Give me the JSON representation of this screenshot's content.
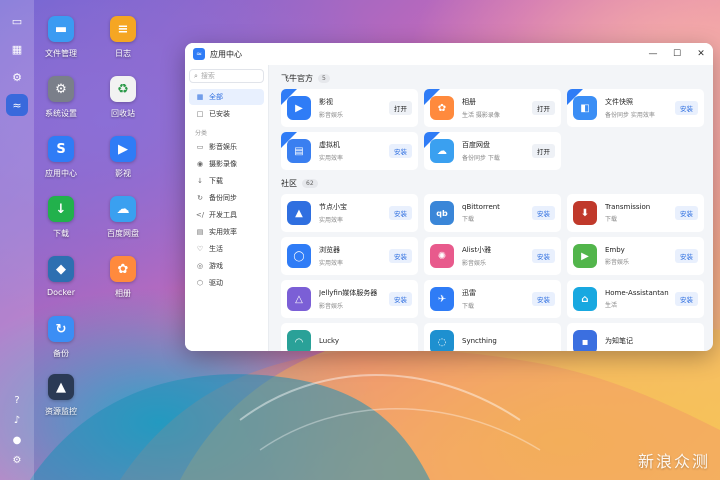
{
  "dock": {
    "top": [
      {
        "icon": "monitor-icon",
        "glyph": "▭"
      },
      {
        "icon": "apps-grid-icon",
        "glyph": "▦"
      },
      {
        "icon": "settings-icon",
        "glyph": "⚙"
      },
      {
        "icon": "app-center-icon",
        "glyph": "≈"
      }
    ],
    "bottom": [
      {
        "icon": "help-icon",
        "glyph": "?"
      },
      {
        "icon": "bell-icon",
        "glyph": "♪"
      },
      {
        "icon": "user-icon",
        "glyph": "●"
      },
      {
        "icon": "gear-icon",
        "glyph": "⚙"
      }
    ]
  },
  "desktop": [
    {
      "label": "文件管理",
      "icon": "folder-icon",
      "glyph": "▬",
      "color": "#3b9bf2"
    },
    {
      "label": "日志",
      "icon": "log-icon",
      "glyph": "≡",
      "color": "#f5a623"
    },
    {
      "label": "系统设置",
      "icon": "settings-icon",
      "glyph": "⚙",
      "color": "#7a7f8a"
    },
    {
      "label": "回收站",
      "icon": "recycle-icon",
      "glyph": "♻",
      "color": "#f2f2f2"
    },
    {
      "label": "应用中心",
      "icon": "store-icon",
      "glyph": "S",
      "color": "#2f7cf6"
    },
    {
      "label": "影视",
      "icon": "video-icon",
      "glyph": "▶",
      "color": "#2f7cf6"
    },
    {
      "label": "下载",
      "icon": "download-icon",
      "glyph": "↓",
      "color": "#22b14c"
    },
    {
      "label": "百度网盘",
      "icon": "cloud-icon",
      "glyph": "☁",
      "color": "#3aa0f0"
    },
    {
      "label": "Docker",
      "icon": "docker-icon",
      "glyph": "◆",
      "color": "#2d6fb1"
    },
    {
      "label": "相册",
      "icon": "photos-icon",
      "glyph": "✿",
      "color": "#ff8a3d"
    },
    {
      "label": "备份",
      "icon": "backup-icon",
      "glyph": "↻",
      "color": "#3b8ef5"
    },
    {
      "label": "资源监控",
      "icon": "monitor-chart-icon",
      "glyph": "▲",
      "color": "#2b3a55"
    }
  ],
  "window": {
    "title": "应用中心",
    "controls": [
      "—",
      "☐",
      "✕"
    ]
  },
  "sidebar": {
    "search_placeholder": "搜索",
    "top_items": [
      {
        "label": "全部",
        "icon": "all-icon",
        "glyph": "▦",
        "active": true
      },
      {
        "label": "已安装",
        "icon": "installed-icon",
        "glyph": "□",
        "active": false
      }
    ],
    "section_title": "分类",
    "categories": [
      {
        "label": "影音娱乐",
        "icon": "media-icon",
        "glyph": "▭"
      },
      {
        "label": "摄影录像",
        "icon": "camera-icon",
        "glyph": "◉"
      },
      {
        "label": "下载",
        "icon": "download-icon",
        "glyph": "↓"
      },
      {
        "label": "备份同步",
        "icon": "sync-icon",
        "glyph": "↻"
      },
      {
        "label": "开发工具",
        "icon": "dev-icon",
        "glyph": "</"
      },
      {
        "label": "实用效率",
        "icon": "tool-icon",
        "glyph": "▤"
      },
      {
        "label": "生活",
        "icon": "life-icon",
        "glyph": "♡"
      },
      {
        "label": "游戏",
        "icon": "game-icon",
        "glyph": "◎"
      },
      {
        "label": "驱动",
        "icon": "driver-icon",
        "glyph": "⬡"
      }
    ]
  },
  "groups": [
    {
      "title": "飞牛官方",
      "count": "5",
      "apps": [
        {
          "name": "影视",
          "desc": "影音娱乐",
          "btn": "打开",
          "install": false,
          "official": true,
          "icon": "video-icon",
          "glyph": "▶",
          "color": "#2f7cf6"
        },
        {
          "name": "相册",
          "desc": "生活  摄影录像",
          "btn": "打开",
          "install": false,
          "official": true,
          "icon": "photos-icon",
          "glyph": "✿",
          "color": "#ff8a3d"
        },
        {
          "name": "文件快照",
          "desc": "备份同步  实用效率",
          "btn": "安装",
          "install": true,
          "official": true,
          "icon": "snapshot-icon",
          "glyph": "◧",
          "color": "#3b8ef5"
        },
        {
          "name": "虚拟机",
          "desc": "实用效率",
          "btn": "安装",
          "install": true,
          "official": true,
          "icon": "vm-icon",
          "glyph": "▤",
          "color": "#3a7ff0"
        },
        {
          "name": "百度网盘",
          "desc": "备份同步  下载",
          "btn": "打开",
          "install": false,
          "official": true,
          "icon": "cloud-icon",
          "glyph": "☁",
          "color": "#3aa0f0"
        }
      ]
    },
    {
      "title": "社区",
      "count": "62",
      "apps": [
        {
          "name": "节点小宝",
          "desc": "实用效率",
          "btn": "安装",
          "install": true,
          "official": false,
          "icon": "node-icon",
          "glyph": "▲",
          "color": "#2f6fe0"
        },
        {
          "name": "qBittorrent",
          "desc": "下载",
          "btn": "安装",
          "install": true,
          "official": false,
          "icon": "qbittorrent-icon",
          "glyph": "qb",
          "color": "#3a86d8"
        },
        {
          "name": "Transmission",
          "desc": "下载",
          "btn": "安装",
          "install": true,
          "official": false,
          "icon": "transmission-icon",
          "glyph": "⬇",
          "color": "#c0392b"
        },
        {
          "name": "浏览器",
          "desc": "实用效率",
          "btn": "安装",
          "install": true,
          "official": false,
          "icon": "browser-icon",
          "glyph": "◯",
          "color": "#2f7cf6"
        },
        {
          "name": "Alist小雅",
          "desc": "影音娱乐",
          "btn": "安装",
          "install": true,
          "official": false,
          "icon": "alist-icon",
          "glyph": "✺",
          "color": "#e85a8c"
        },
        {
          "name": "Emby",
          "desc": "影音娱乐",
          "btn": "安装",
          "install": true,
          "official": false,
          "icon": "emby-icon",
          "glyph": "▶",
          "color": "#52b54b"
        },
        {
          "name": "Jellyfin媒体服务器",
          "desc": "影音娱乐",
          "btn": "安装",
          "install": true,
          "official": false,
          "icon": "jellyfin-icon",
          "glyph": "△",
          "color": "#7b5fd6"
        },
        {
          "name": "迅雷",
          "desc": "下载",
          "btn": "安装",
          "install": true,
          "official": false,
          "icon": "thunder-icon",
          "glyph": "✈",
          "color": "#2f7cf6"
        },
        {
          "name": "Home-Assistantan",
          "desc": "生活",
          "btn": "安装",
          "install": true,
          "official": false,
          "icon": "home-assistant-icon",
          "glyph": "⌂",
          "color": "#18a8e0"
        },
        {
          "name": "Lucky",
          "desc": "",
          "btn": "",
          "install": true,
          "official": false,
          "icon": "lucky-icon",
          "glyph": "◠",
          "color": "#2aa198"
        },
        {
          "name": "Syncthing",
          "desc": "",
          "btn": "",
          "install": true,
          "official": false,
          "icon": "syncthing-icon",
          "glyph": "◌",
          "color": "#1e90d0"
        },
        {
          "name": "为知笔记",
          "desc": "",
          "btn": "",
          "install": true,
          "official": false,
          "icon": "wiznote-icon",
          "glyph": "▪",
          "color": "#3b6fe0"
        }
      ]
    }
  ],
  "watermark": "新浪众测"
}
